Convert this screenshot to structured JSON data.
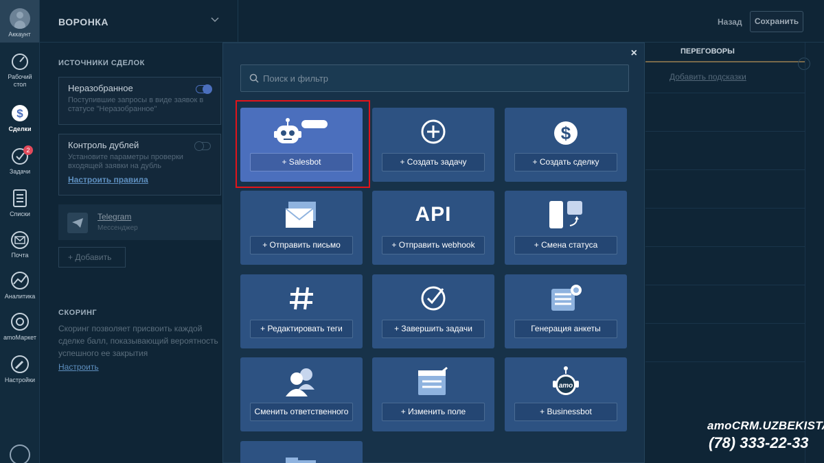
{
  "sidebar": {
    "account": "Аккаунт",
    "items": [
      {
        "label": "Рабочий стол",
        "line1": "Рабочий",
        "line2": "стол",
        "icon": "dashboard-icon"
      },
      {
        "label": "Сделки",
        "icon": "deals-dollar-icon",
        "active": true
      },
      {
        "label": "Задачи",
        "icon": "tasks-check-icon",
        "badge": "2"
      },
      {
        "label": "Списки",
        "icon": "lists-icon"
      },
      {
        "label": "Почта",
        "icon": "mail-icon"
      },
      {
        "label": "Аналитика",
        "icon": "analytics-icon"
      },
      {
        "label": "amoМаркет",
        "icon": "market-icon"
      },
      {
        "label": "Настройки",
        "icon": "settings-wrench-icon"
      }
    ]
  },
  "header": {
    "funnel_title": "ВОРОНКА",
    "back": "Назад",
    "save": "Сохранить"
  },
  "sources": {
    "title": "ИСТОЧНИКИ СДЕЛОК",
    "unsorted": {
      "name": "Неразобранное",
      "desc": "Поступившие запросы в виде заявок в статусе \"Неразобранное\""
    },
    "duplicates": {
      "name": "Контроль дублей",
      "desc": "Установите параметры проверки входящей заявки на дубль",
      "link": "Настроить правила"
    },
    "telegram": {
      "name": "Telegram",
      "sub": "Мессенджер"
    },
    "add": "+ Добавить"
  },
  "scoring": {
    "title": "СКОРИНГ",
    "desc": "Скоринг позволяет присвоить каждой сделке балл, показывающий вероятность успешного ее закрытия",
    "link": "Настроить"
  },
  "pipeline": {
    "column_title": "ПЕРЕГОВОРЫ",
    "hint": "Добавить подсказки"
  },
  "modal": {
    "search_placeholder": "Поиск и фильтр",
    "close": "×",
    "tiles": [
      {
        "label": "+ Salesbot",
        "icon": "robot-icon",
        "highlighted": true
      },
      {
        "label": "+ Создать задачу",
        "icon": "plus-circle-icon"
      },
      {
        "label": "+ Создать сделку",
        "icon": "dollar-icon"
      },
      {
        "label": "+ Отправить письмо",
        "icon": "envelope-icon"
      },
      {
        "label": "+ Отправить webhook",
        "icon": "api-icon",
        "icon_text": "API"
      },
      {
        "label": "+ Смена статуса",
        "icon": "status-change-icon"
      },
      {
        "label": "+ Редактировать теги",
        "icon": "hashtag-icon"
      },
      {
        "label": "+ Завершить задачи",
        "icon": "check-circle-icon"
      },
      {
        "label": "Генерация анкеты",
        "icon": "form-generate-icon"
      },
      {
        "label": "Сменить ответственного",
        "icon": "users-icon"
      },
      {
        "label": "+ Изменить поле",
        "icon": "edit-field-icon"
      },
      {
        "label": "+ Businessbot",
        "icon": "amo-bot-icon",
        "icon_text": "amo"
      }
    ]
  },
  "watermark": {
    "brand": "amoCRM.UZBEKISTAN",
    "phone": "(78) 333-22-33"
  }
}
